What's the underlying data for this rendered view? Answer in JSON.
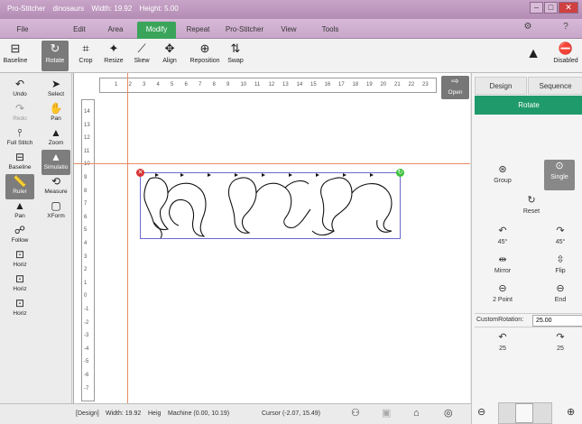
{
  "window": {
    "app": "Pro-Stitcher",
    "file": "dinosaurs",
    "width": "Width: 19.92",
    "height": "Height: 5.00"
  },
  "menu": {
    "tabs": [
      {
        "label": "File"
      },
      {
        "label": "Edit"
      },
      {
        "label": "Area"
      },
      {
        "label": "Modify"
      },
      {
        "label": "Repeat"
      },
      {
        "label": "Pro-Stitcher"
      },
      {
        "label": "View"
      },
      {
        "label": "Tools"
      }
    ],
    "active": "Modify"
  },
  "ribbon": {
    "items": [
      {
        "label": "Baseline",
        "icon": "baseline-icon"
      },
      {
        "label": "Rotate",
        "icon": "rotate-icon"
      },
      {
        "label": "Crop",
        "icon": "crop-icon"
      },
      {
        "label": "Resize",
        "icon": "resize-icon"
      },
      {
        "label": "Skew",
        "icon": "skew-icon"
      },
      {
        "label": "Align",
        "icon": "align-icon"
      },
      {
        "label": "Reposition",
        "icon": "reposition-icon"
      },
      {
        "label": "Swap",
        "icon": "swap-icon"
      }
    ],
    "disabled_label": "Disabled"
  },
  "left_tools": [
    {
      "label": "Undo",
      "icon": "undo-icon"
    },
    {
      "label": "Select",
      "icon": "select-icon"
    },
    {
      "label": "Redo",
      "icon": "redo-icon"
    },
    {
      "label": "Pan",
      "icon": "pan-icon"
    },
    {
      "label": "Full Stitch",
      "icon": "full-stitch-icon"
    },
    {
      "label": "Zoom",
      "icon": "zoom-icon"
    },
    {
      "label": "Baseline",
      "icon": "baseline-icon"
    },
    {
      "label": "Simulatio",
      "icon": "simulation-icon"
    },
    {
      "label": "Ruler",
      "icon": "ruler-icon"
    },
    {
      "label": "Measure",
      "icon": "measure-icon"
    },
    {
      "label": "Pan",
      "icon": "pan-icon"
    },
    {
      "label": "XForm",
      "icon": "xform-icon"
    },
    {
      "label": "Follow",
      "icon": "follow-icon"
    },
    {
      "label": "Horiz",
      "icon": "horiz-icon"
    },
    {
      "label": "Horiz",
      "icon": "horiz-icon"
    },
    {
      "label": "Horiz",
      "icon": "horiz-icon"
    }
  ],
  "canvas": {
    "open_label": "Open",
    "hruler_ticks": [
      "1",
      "2",
      "3",
      "4",
      "5",
      "6",
      "7",
      "8",
      "9",
      "10",
      "11",
      "12",
      "13",
      "14",
      "15",
      "16",
      "17",
      "18",
      "19",
      "20",
      "21",
      "22",
      "23"
    ],
    "vruler_ticks": [
      "14",
      "13",
      "12",
      "11",
      "10",
      "9",
      "8",
      "7",
      "6",
      "5",
      "4",
      "3",
      "2",
      "1",
      "0",
      "-1",
      "-2",
      "-3",
      "-4",
      "-5",
      "-6",
      "-7"
    ]
  },
  "right_panel": {
    "tabs": [
      {
        "label": "Design"
      },
      {
        "label": "Sequence"
      }
    ],
    "section": "Rotate",
    "buttons": [
      {
        "label": "Group",
        "icon": "group-icon"
      },
      {
        "label": "Single",
        "icon": "single-icon"
      },
      {
        "label": "Reset",
        "icon": "reset-icon"
      },
      {
        "label": "45°",
        "icon": "rotate-left-icon"
      },
      {
        "label": "45°",
        "icon": "rotate-right-icon"
      },
      {
        "label": "Mirror",
        "icon": "mirror-icon"
      },
      {
        "label": "Flip",
        "icon": "flip-icon"
      },
      {
        "label": "2 Point",
        "icon": "two-point-icon"
      },
      {
        "label": "End",
        "icon": "end-icon"
      },
      {
        "label": "25",
        "icon": "rotate-left-icon"
      },
      {
        "label": "25",
        "icon": "rotate-right-icon"
      }
    ],
    "custom_rotation_label": "CustomRotation:",
    "custom_rotation_value": "25.00"
  },
  "status": {
    "mode": "[Design]",
    "width": "Width: 19.92",
    "height": "Heig",
    "machine": "Machine (0.00, 10.19)",
    "cursor": "Cursor (-2.07, 15.49)"
  },
  "colors": {
    "accent_green": "#3aa45a",
    "rotate_header": "#1f9a6a",
    "guide_line": "#e88a66",
    "selection": "#6a6ad0"
  }
}
